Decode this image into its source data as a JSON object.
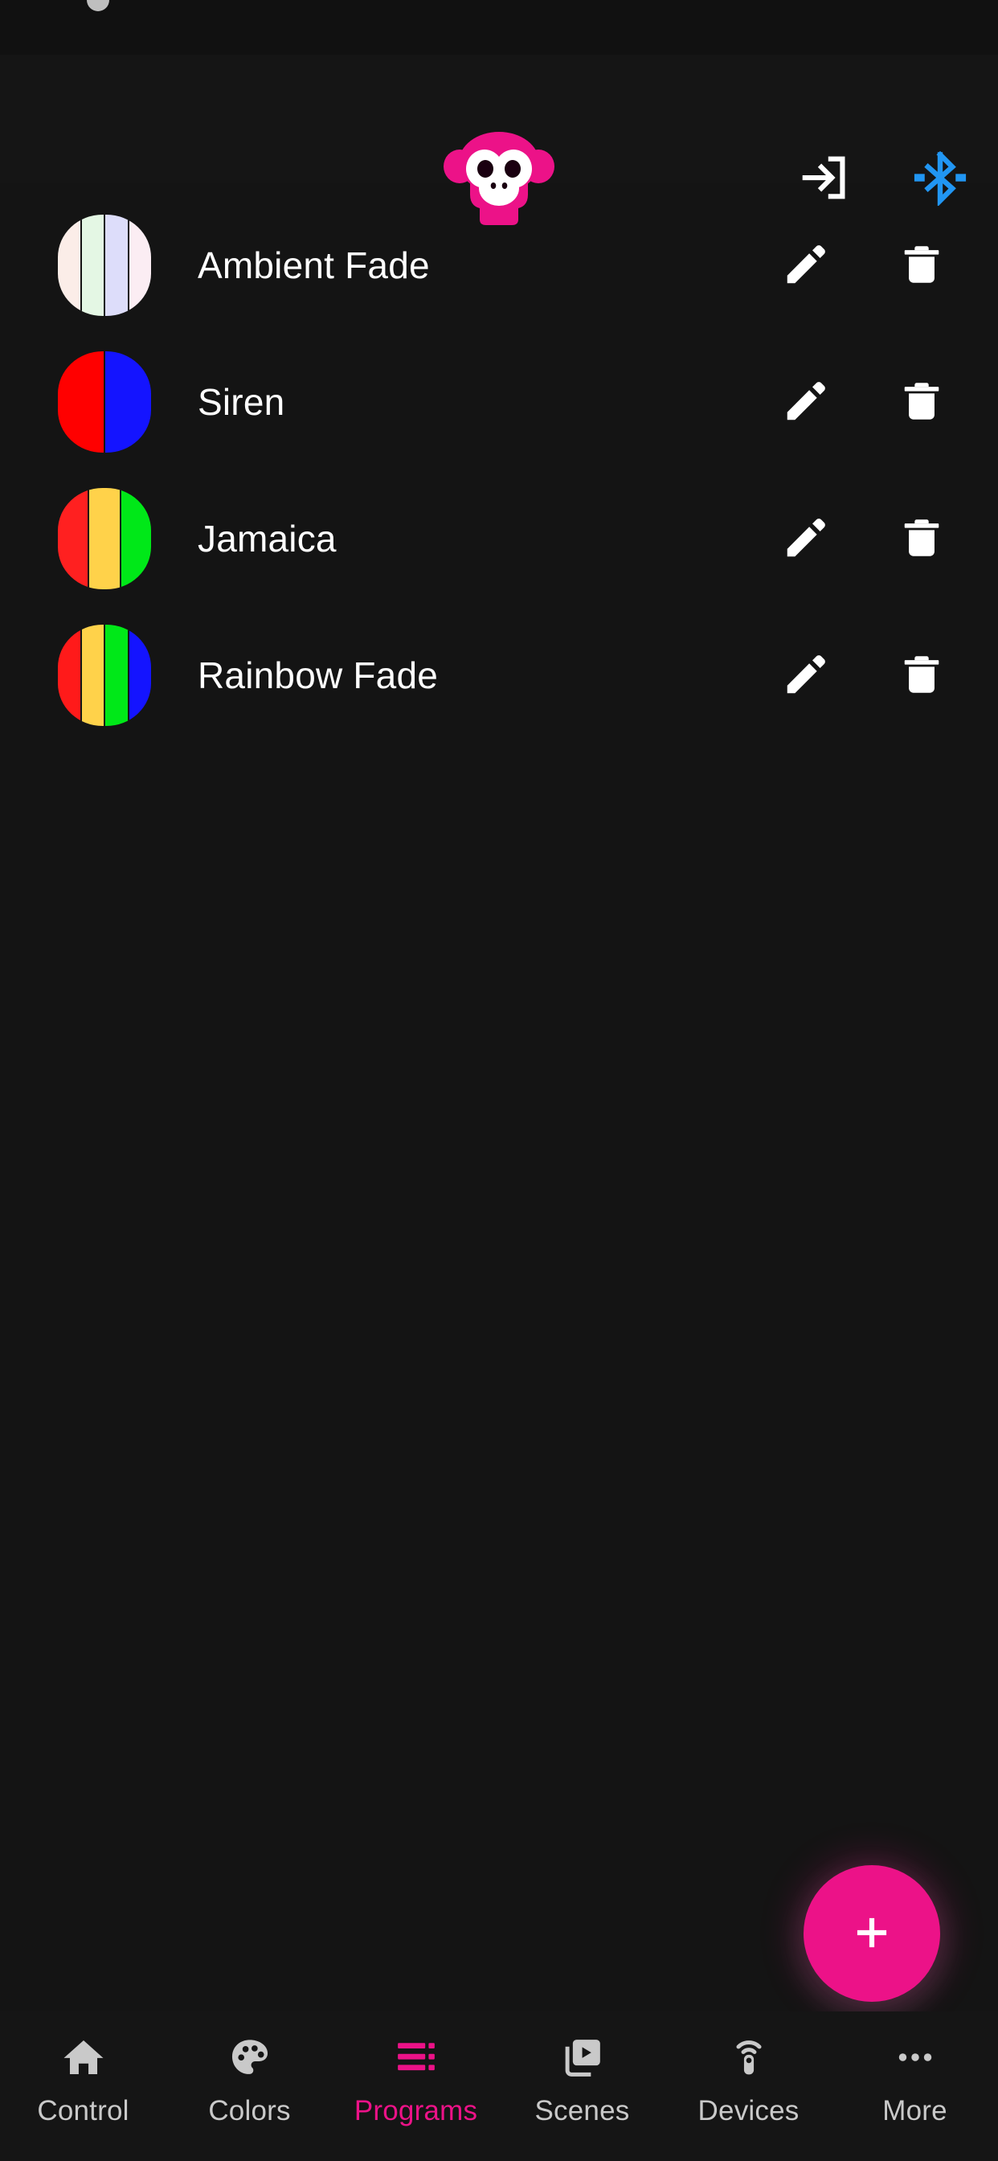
{
  "theme": {
    "background": "#141414",
    "surface": "#151515",
    "accent": "#EC1288",
    "bluetooth_blue": "#2196F3",
    "text_primary": "#FFFFFF",
    "text_muted": "#C9C9C9"
  },
  "header": {
    "logo_name": "monkey-logo",
    "logo_color": "#EC1288",
    "actions": [
      {
        "name": "login-icon",
        "label": "Login"
      },
      {
        "name": "bluetooth-icon",
        "label": "Bluetooth"
      }
    ]
  },
  "programs": [
    {
      "name": "Ambient Fade",
      "colors": [
        "#FBEDE8",
        "#E4F7E4",
        "#DDDDFA",
        "#FBEDF3"
      ],
      "edit_label": "Edit",
      "delete_label": "Delete"
    },
    {
      "name": "Siren",
      "colors": [
        "#FF0000",
        "#1414FF"
      ],
      "edit_label": "Edit",
      "delete_label": "Delete"
    },
    {
      "name": "Jamaica",
      "colors": [
        "#FF2020",
        "#FFD24A",
        "#00E818"
      ],
      "edit_label": "Edit",
      "delete_label": "Delete"
    },
    {
      "name": "Rainbow Fade",
      "colors": [
        "#FF1A1A",
        "#FFD24A",
        "#00E818",
        "#1414FF"
      ],
      "edit_label": "Edit",
      "delete_label": "Delete"
    }
  ],
  "fab": {
    "label": "+",
    "name": "add-program-button",
    "color": "#EC1288"
  },
  "bottom_nav": {
    "active_index": 2,
    "items": [
      {
        "label": "Control",
        "icon": "home-icon"
      },
      {
        "label": "Colors",
        "icon": "palette-icon"
      },
      {
        "label": "Programs",
        "icon": "program-list-icon"
      },
      {
        "label": "Scenes",
        "icon": "video-library-icon"
      },
      {
        "label": "Devices",
        "icon": "remote-signal-icon"
      },
      {
        "label": "More",
        "icon": "more-horizontal-icon"
      }
    ]
  }
}
